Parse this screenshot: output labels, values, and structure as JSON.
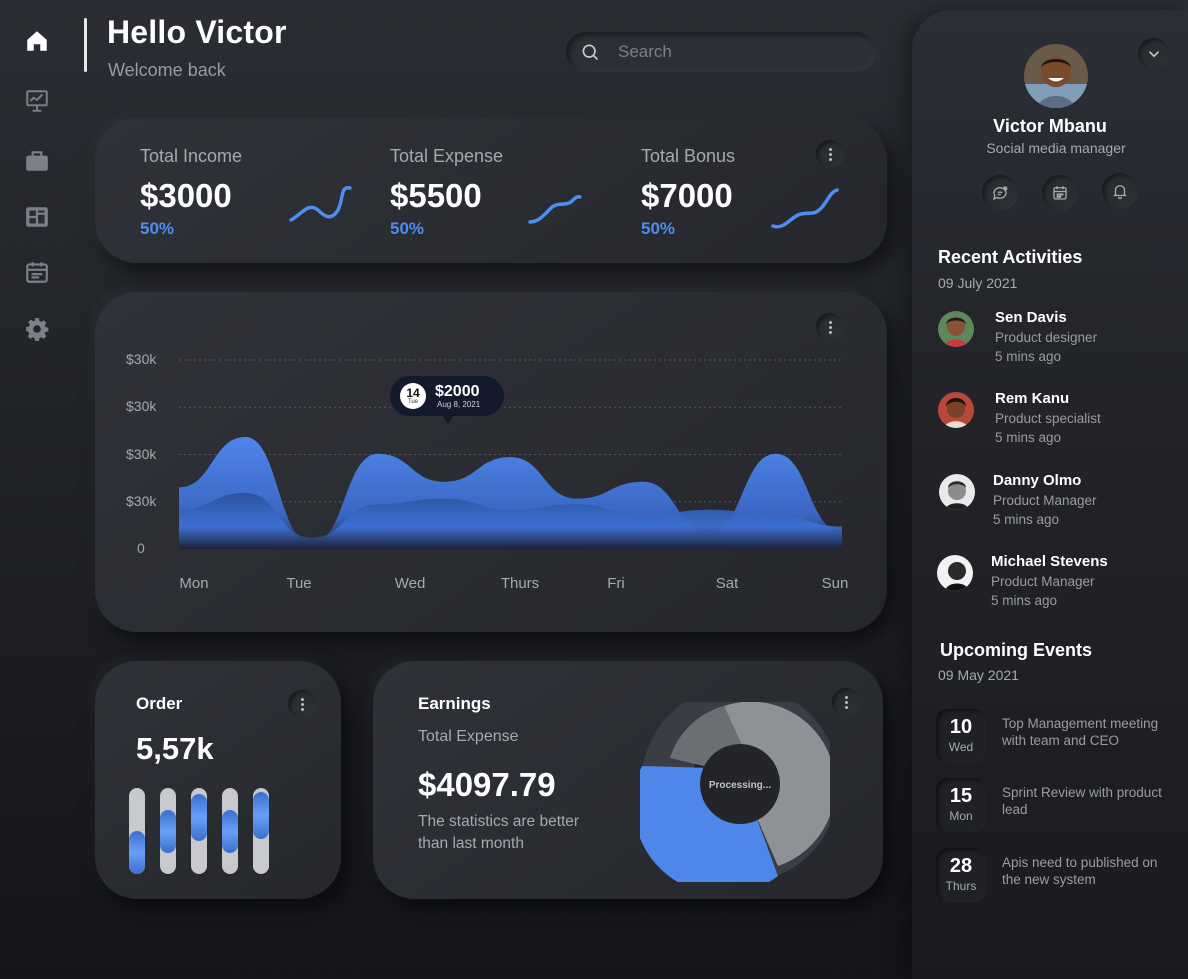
{
  "header": {
    "greeting": "Hello Victor",
    "subtitle": "Welcome back",
    "search_placeholder": "Search"
  },
  "sidebar": {
    "items": [
      {
        "icon": "home-icon",
        "active": true
      },
      {
        "icon": "presentation-chart-icon"
      },
      {
        "icon": "briefcase-icon"
      },
      {
        "icon": "dashboard-icon"
      },
      {
        "icon": "calendar-list-icon"
      },
      {
        "icon": "gear-icon"
      }
    ]
  },
  "stats": [
    {
      "label": "Total Income",
      "value": "$3000",
      "percent": "50%"
    },
    {
      "label": "Total Expense",
      "value": "$5500",
      "percent": "50%"
    },
    {
      "label": "Total Bonus",
      "value": "$7000",
      "percent": "50%"
    }
  ],
  "chart": {
    "tooltip": {
      "day": "14",
      "weekday": "Tue",
      "amount": "$2000",
      "date": "Aug 8, 2021"
    }
  },
  "chart_data": {
    "type": "area",
    "categories": [
      "Mon",
      "Tue",
      "Wed",
      "Thurs",
      "Fri",
      "Sat",
      "Sun"
    ],
    "y_tick_labels": [
      "$30k",
      "$30k",
      "$30k",
      "$30k",
      "0"
    ],
    "grid": true,
    "series": [
      {
        "values": [
          0.55,
          1.0,
          0.05,
          0.85,
          0.6,
          0.82,
          0.45,
          0.6,
          0.15,
          0.85,
          0.15
        ]
      },
      {
        "values": [
          0.35,
          0.5,
          0.1,
          0.4,
          0.45,
          0.35,
          0.4,
          0.3,
          0.35,
          0.3,
          0.2
        ]
      }
    ],
    "colors": [
      "#4f86ea",
      "#2f5fb8"
    ]
  },
  "order": {
    "title": "Order",
    "value": "5,57k",
    "bars": [
      0.5,
      0.5,
      0.55,
      0.5,
      0.55
    ]
  },
  "earnings": {
    "title": "Earnings",
    "subtitle": "Total Expense",
    "value": "$4097.79",
    "note_line1": "The statistics are better",
    "note_line2": "than last month",
    "donut_label": "Processing..."
  },
  "profile": {
    "name": "Victor Mbanu",
    "role": "Social media manager"
  },
  "activities": {
    "title": "Recent Activities",
    "date": "09 July 2021",
    "items": [
      {
        "name": "Sen Davis",
        "role": "Product designer",
        "time": "5 mins ago"
      },
      {
        "name": "Rem Kanu",
        "role": "Product specialist",
        "time": "5 mins ago"
      },
      {
        "name": "Danny Olmo",
        "role": "Product Manager",
        "time": "5 mins ago"
      },
      {
        "name": "Michael Stevens",
        "role": "Product Manager",
        "time": "5 mins ago"
      }
    ]
  },
  "events": {
    "title": "Upcoming Events",
    "date": "09 May 2021",
    "items": [
      {
        "day": "10",
        "weekday": "Wed",
        "line1": "Top Management meeting",
        "line2": "with team and CEO"
      },
      {
        "day": "15",
        "weekday": "Mon",
        "line1": "Sprint Review with product",
        "line2": "lead"
      },
      {
        "day": "28",
        "weekday": "Thurs",
        "line1": "Apis need to published on",
        "line2": "the new system"
      }
    ]
  },
  "colors": {
    "accent": "#4d8ef0",
    "background": "#232529",
    "card": "#2c2f35"
  }
}
